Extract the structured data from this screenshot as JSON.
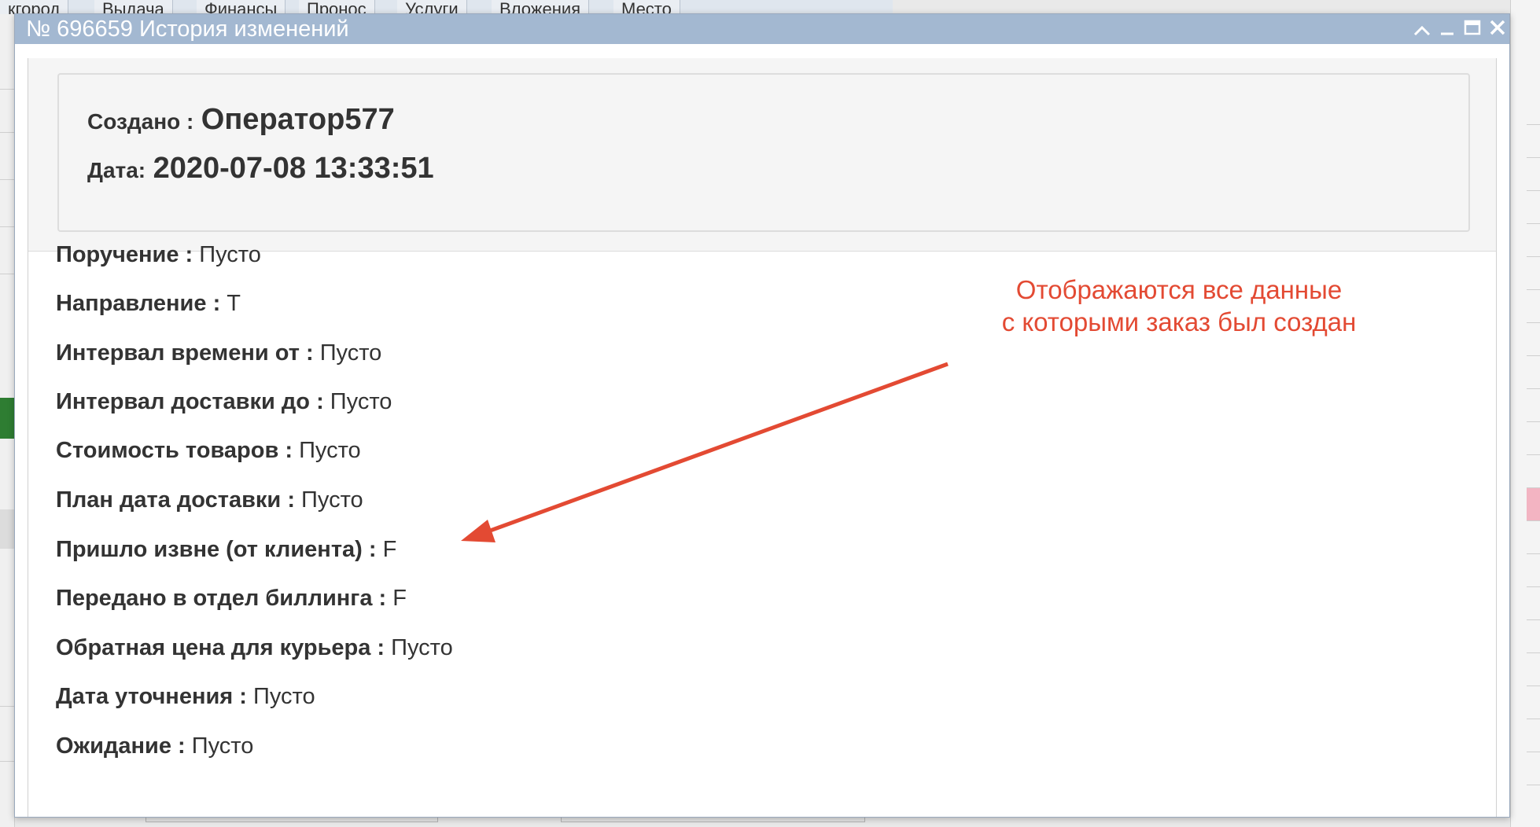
{
  "dialog": {
    "title": "№ 696659 История изменений",
    "controls": {
      "collapse_icon": "chevron-up-icon",
      "minimize_icon": "minimize-icon",
      "maximize_icon": "maximize-icon",
      "close_icon": "close-icon"
    }
  },
  "header": {
    "created_label": "Создано :",
    "created_value": "Оператор577",
    "date_label": "Дата:",
    "date_value": "2020-07-08 13:33:51"
  },
  "fields": [
    {
      "label": "Поручение :",
      "value": "Пусто"
    },
    {
      "label": "Направление :",
      "value": "Т"
    },
    {
      "label": "Интервал времени от :",
      "value": "Пусто"
    },
    {
      "label": "Интервал доставки до :",
      "value": "Пусто"
    },
    {
      "label": "Стоимость товаров :",
      "value": "Пусто"
    },
    {
      "label": "План дата доставки :",
      "value": "Пусто"
    },
    {
      "label": "Пришло извне (от клиента) :",
      "value": "F"
    },
    {
      "label": "Передано в отдел биллинга :",
      "value": "F"
    },
    {
      "label": "Обратная цена для курьера :",
      "value": "Пусто"
    },
    {
      "label": "Дата уточнения :",
      "value": "Пусто"
    },
    {
      "label": "Ожидание :",
      "value": "Пусто"
    }
  ],
  "annotation": {
    "line1": "Отображаются все данные",
    "line2": "с которыми заказ был создан",
    "color": "#e34a33"
  },
  "background": {
    "tabs": [
      "кгород",
      "Выдача",
      "Финансы",
      "Пронос",
      "Услуги",
      "Вложения",
      "Место"
    ]
  },
  "colors": {
    "titlebar": "#a3b8d1",
    "header_bg": "#f5f5f5"
  }
}
